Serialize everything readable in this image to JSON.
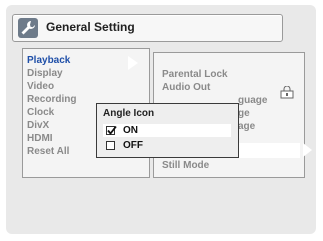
{
  "header": {
    "title": "General Setting",
    "icon": "wrench-icon"
  },
  "menu": {
    "items": [
      {
        "label": "Playback",
        "selected": true
      },
      {
        "label": "Display"
      },
      {
        "label": "Video"
      },
      {
        "label": "Recording"
      },
      {
        "label": "Clock"
      },
      {
        "label": "DivX"
      },
      {
        "label": "HDMI"
      },
      {
        "label": "Reset All"
      }
    ]
  },
  "submenu": {
    "items": [
      {
        "label": "Parental Lock",
        "icon": "lock-icon"
      },
      {
        "label": "Audio Out"
      },
      {
        "label": "guage"
      },
      {
        "label": "ge"
      },
      {
        "label": "age"
      },
      {
        "label": ""
      },
      {
        "label": "Still Mode"
      }
    ]
  },
  "dialog": {
    "title": "Angle Icon",
    "options": [
      {
        "label": "ON",
        "checked": true
      },
      {
        "label": "OFF",
        "checked": false
      }
    ]
  },
  "colors": {
    "selected_text": "#1f4fa8",
    "dim_text": "#8a8a8a"
  }
}
